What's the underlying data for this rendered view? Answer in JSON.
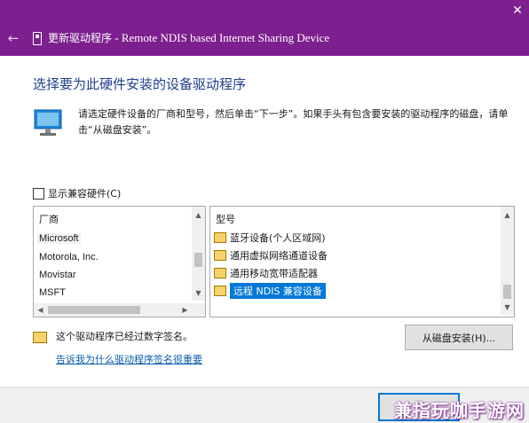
{
  "window": {
    "title_prefix": "更新驱动程序",
    "title_suffix": " - Remote NDIS based Internet Sharing Device",
    "close_glyph": "✕",
    "back_glyph": "←",
    "accent_color": "#7d1f8f"
  },
  "page": {
    "heading": "选择要为此硬件安装的设备驱动程序",
    "instructions": "请选定硬件设备的厂商和型号，然后单击“下一步”。如果手头有包含要安装的驱动程序的磁盘，请单击“从磁盘安装”。",
    "show_compatible_label": "显示兼容硬件(C)",
    "show_compatible_checked": false
  },
  "manufacturer_list": {
    "header": "厂商",
    "items": [
      "Microsoft",
      "Motorola, Inc.",
      "Movistar",
      "MSFT"
    ],
    "selected": "Microsoft"
  },
  "model_list": {
    "header": "型号",
    "items": [
      "蓝牙设备(个人区域网)",
      "通用虚拟网络通道设备",
      "通用移动宽带适配器",
      "远程 NDIS 兼容设备"
    ],
    "selected": "远程 NDIS 兼容设备"
  },
  "signature": {
    "status_text": "这个驱动程序已经过数字签名。",
    "link_text": "告诉我为什么驱动程序签名很重要"
  },
  "buttons": {
    "have_disk": "从磁盘安装(H)..."
  },
  "watermark": "兼指玩咖手游网"
}
